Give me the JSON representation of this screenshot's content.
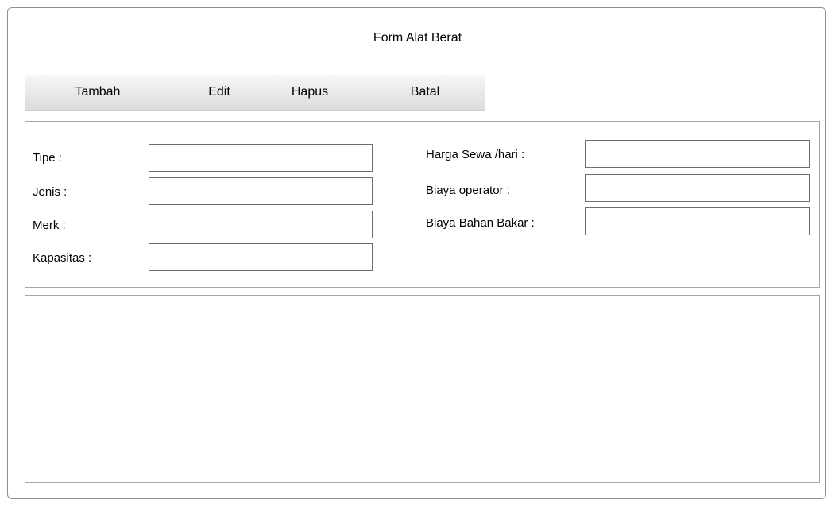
{
  "window": {
    "title": "Form Alat Berat"
  },
  "toolbar": {
    "tambah_label": "Tambah",
    "edit_label": "Edit",
    "hapus_label": "Hapus",
    "batal_label": "Batal"
  },
  "form": {
    "left": {
      "tipe_label": "Tipe :",
      "tipe_value": "",
      "jenis_label": "Jenis :",
      "jenis_value": "",
      "merk_label": "Merk :",
      "merk_value": "",
      "kapasitas_label": "Kapasitas :",
      "kapasitas_value": ""
    },
    "right": {
      "harga_sewa_label": "Harga Sewa /hari :",
      "harga_sewa_value": "",
      "biaya_operator_label": "Biaya operator :",
      "biaya_operator_value": "",
      "biaya_bahan_bakar_label": "Biaya Bahan Bakar :",
      "biaya_bahan_bakar_value": ""
    }
  },
  "colors": {
    "border": "#8f8f8f",
    "toolbar_top": "#f7f7f7",
    "toolbar_bottom": "#dcdcdc"
  }
}
